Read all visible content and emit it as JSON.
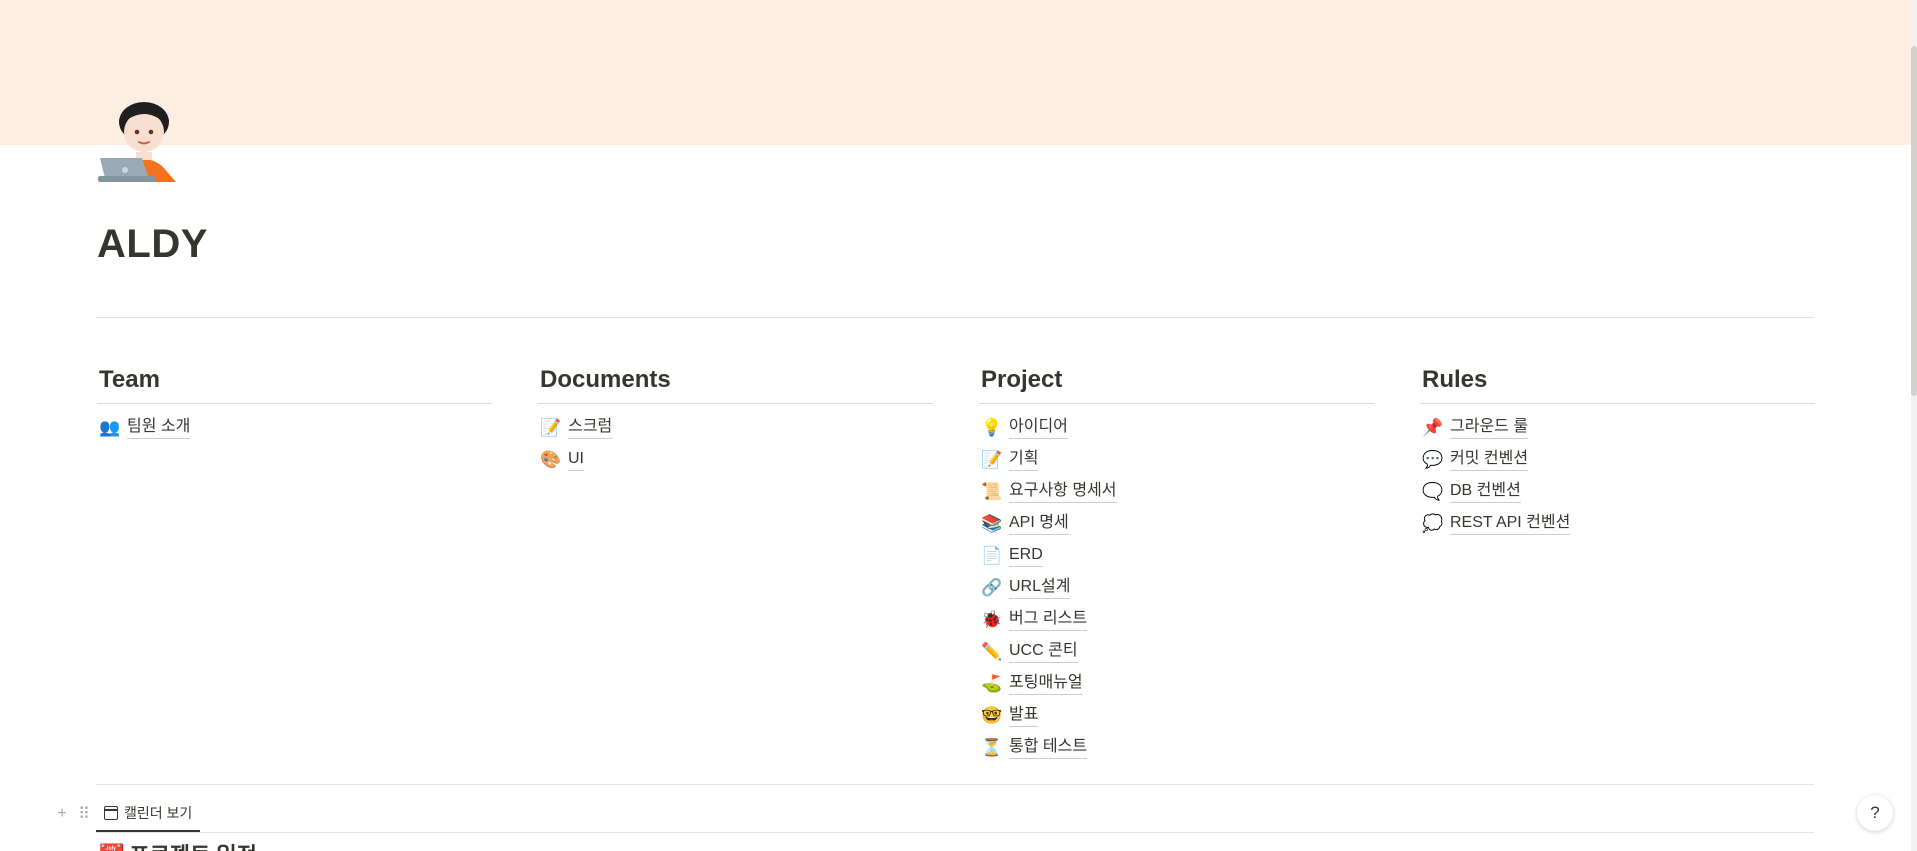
{
  "page": {
    "title": "ALDY",
    "icon": "person-with-laptop-icon",
    "cover_color": "#fdeee2"
  },
  "columns": [
    {
      "heading": "Team",
      "items": [
        {
          "icon": "👥",
          "label": "팀원 소개"
        }
      ]
    },
    {
      "heading": "Documents",
      "items": [
        {
          "icon": "📝",
          "label": "스크럼"
        },
        {
          "icon": "🎨",
          "label": "UI"
        }
      ]
    },
    {
      "heading": "Project",
      "items": [
        {
          "icon": "💡",
          "label": "아이디어"
        },
        {
          "icon": "📝",
          "label": "기획"
        },
        {
          "icon": "📜",
          "label": "요구사항 명세서"
        },
        {
          "icon": "📚",
          "label": "API 명세"
        },
        {
          "icon": "📄",
          "label": "ERD"
        },
        {
          "icon": "🔗",
          "label": "URL설계"
        },
        {
          "icon": "🐞",
          "label": "버그 리스트"
        },
        {
          "icon": "✏️",
          "label": "UCC 콘티"
        },
        {
          "icon": "⛳",
          "label": "포팅매뉴얼"
        },
        {
          "icon": "🤓",
          "label": "발표"
        },
        {
          "icon": "⏳",
          "label": "통합 테스트"
        }
      ]
    },
    {
      "heading": "Rules",
      "items": [
        {
          "icon": "📌",
          "label": "그라운드 룰"
        },
        {
          "icon": "💬",
          "label": "커밋 컨벤션"
        },
        {
          "icon": "🗨️",
          "label": "DB 컨벤션"
        },
        {
          "icon": "💭",
          "label": "REST API 컨벤션"
        }
      ]
    }
  ],
  "view_bar": {
    "add_icon": "+",
    "drag_icon": "⠿",
    "tab_label": "캘린더 보기"
  },
  "next_section": {
    "icon": "📆",
    "heading": "프로젝트 일정"
  },
  "help": {
    "label": "?"
  }
}
